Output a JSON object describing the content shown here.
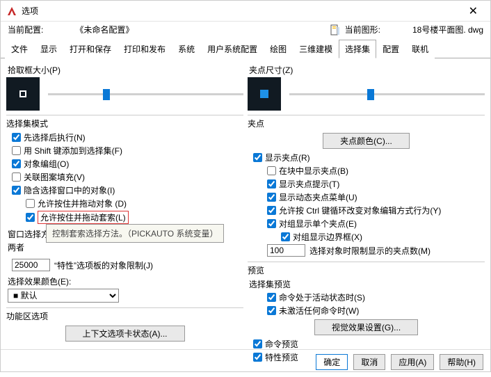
{
  "title": "选项",
  "profile": {
    "label": "当前配置:",
    "value": "《未命名配置》"
  },
  "drawing": {
    "label": "当前图形:",
    "value": "18号楼平面图. dwg"
  },
  "tabs": [
    "文件",
    "显示",
    "打开和保存",
    "打印和发布",
    "系统",
    "用户系统配置",
    "绘图",
    "三维建模",
    "选择集",
    "配置",
    "联机"
  ],
  "active_tab": 8,
  "left": {
    "pickbox": "拾取框大小(P)",
    "sel_mode_title": "选择集模式",
    "m1": "先选择后执行(N)",
    "m2": "用 Shift 键添加到选择集(F)",
    "m3": "对象编组(O)",
    "m4": "关联图案填充(V)",
    "m5": "隐含选择窗口中的对象(I)",
    "m5a": "允许按住并拖动对象 (D)",
    "m5b": "允许按住并拖动套索(L)",
    "win_method_label": "窗口选择方法(L):",
    "win_method_truncated": "两者",
    "tooltip": "控制套索选择方法。（PICKAUTO 系统变量）",
    "limit_num": "25000",
    "limit_label": "“特性”选项板的对象限制(J)",
    "effect_color_label": "选择效果颜色(E):",
    "effect_color_value": "默认",
    "ribbon_title": "功能区选项",
    "ribbon_btn": "上下文选项卡状态(A)..."
  },
  "right": {
    "gripsize": "夹点尺寸(Z)",
    "grips_title": "夹点",
    "grips_color_btn": "夹点颜色(C)...",
    "g1": "显示夹点(R)",
    "g1a": "在块中显示夹点(B)",
    "g1b": "显示夹点提示(T)",
    "g1c": "显示动态夹点菜单(U)",
    "g1d": "允许按 Ctrl 键循环改变对象编辑方式行为(Y)",
    "g1e": "对组显示单个夹点(E)",
    "g1e1": "对组显示边界框(X)",
    "grip_limit_num": "100",
    "grip_limit_label": "选择对象时限制显示的夹点数(M)",
    "preview_title": "预览",
    "preview_sub": "选择集预览",
    "p1": "命令处于活动状态时(S)",
    "p2": "未激活任何命令时(W)",
    "visual_btn": "视觉效果设置(G)...",
    "p3": "命令预览",
    "p4": "特性预览"
  },
  "footer": {
    "ok": "确定",
    "cancel": "取消",
    "apply": "应用(A)",
    "help": "帮助(H)"
  }
}
